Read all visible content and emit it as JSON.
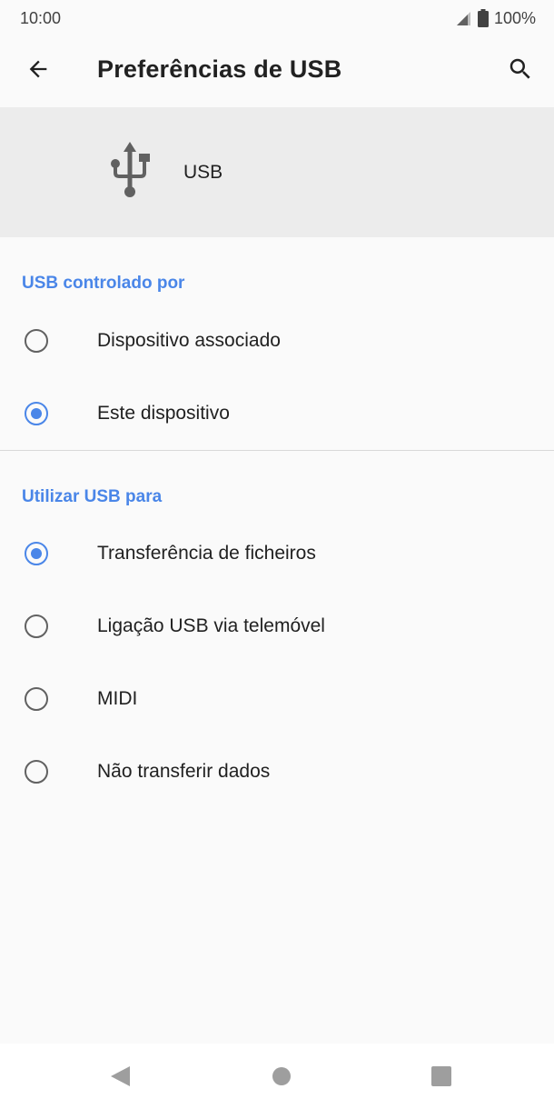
{
  "status_bar": {
    "time": "10:00",
    "battery": "100%",
    "icons": [
      "signal-icon",
      "battery-icon"
    ]
  },
  "app_bar": {
    "title": "Preferências de USB",
    "back_icon": "arrow-back-icon",
    "search_icon": "search-icon"
  },
  "header": {
    "icon": "usb-icon",
    "label": "USB"
  },
  "sections": [
    {
      "title": "USB controlado por",
      "options": [
        {
          "label": "Dispositivo associado",
          "selected": false
        },
        {
          "label": "Este dispositivo",
          "selected": true
        }
      ]
    },
    {
      "title": "Utilizar USB para",
      "options": [
        {
          "label": "Transferência de ficheiros",
          "selected": true
        },
        {
          "label": "Ligação USB via telemóvel",
          "selected": false
        },
        {
          "label": "MIDI",
          "selected": false
        },
        {
          "label": "Não transferir dados",
          "selected": false
        }
      ]
    }
  ],
  "nav_bar": {
    "icons": [
      "back-triangle-icon",
      "home-circle-icon",
      "recents-square-icon"
    ]
  },
  "colors": {
    "accent": "#4a86e8",
    "header_bg": "#ececec",
    "background": "#fafafa"
  }
}
